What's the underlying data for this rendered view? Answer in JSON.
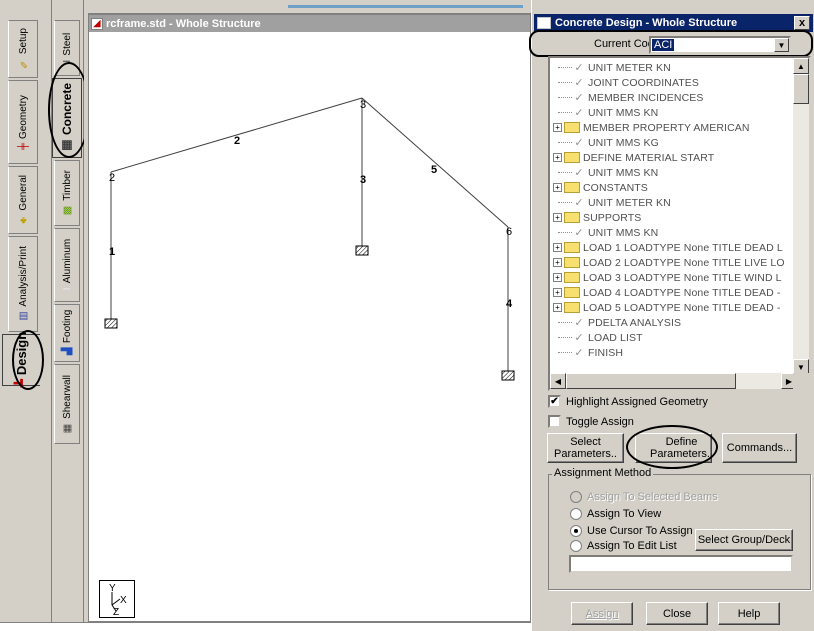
{
  "outer_tabs": [
    {
      "label": "Setup",
      "icon": "setup-icon"
    },
    {
      "label": "Geometry",
      "icon": "geometry-icon"
    },
    {
      "label": "General",
      "icon": "general-icon"
    },
    {
      "label": "Analysis/Print",
      "icon": "analysis-icon"
    },
    {
      "label": "Design",
      "icon": "design-icon",
      "active": true
    }
  ],
  "inner_tabs": [
    {
      "label": "Steel",
      "icon": "steel-icon"
    },
    {
      "label": "Concrete",
      "icon": "concrete-icon",
      "active": true
    },
    {
      "label": "Timber",
      "icon": "timber-icon"
    },
    {
      "label": "Aluminum",
      "icon": "aluminum-icon"
    },
    {
      "label": "Footing",
      "icon": "footing-icon"
    },
    {
      "label": "Shearwall",
      "icon": "shearwall-icon"
    }
  ],
  "drawing_window": {
    "title": "rcframe.std - Whole Structure",
    "node_labels": [
      "2",
      "3",
      "6"
    ],
    "member_labels": [
      "1",
      "2",
      "3",
      "5",
      "4"
    ],
    "axis_labels": {
      "y": "Y",
      "z": "Z",
      "x": "X"
    }
  },
  "dialog": {
    "title": "Concrete Design - Whole Structure",
    "close_glyph": "x",
    "current_code_label": "Current Code:",
    "current_code_value": "ACI",
    "tree_items": [
      {
        "type": "check",
        "text": "UNIT METER KN"
      },
      {
        "type": "check",
        "text": "JOINT COORDINATES"
      },
      {
        "type": "check",
        "text": "MEMBER INCIDENCES"
      },
      {
        "type": "check",
        "text": "UNIT MMS KN"
      },
      {
        "type": "folder",
        "text": "MEMBER PROPERTY AMERICAN"
      },
      {
        "type": "check",
        "text": "UNIT MMS KG"
      },
      {
        "type": "folder",
        "text": "DEFINE MATERIAL START"
      },
      {
        "type": "check",
        "text": "UNIT MMS KN"
      },
      {
        "type": "folder",
        "text": "CONSTANTS"
      },
      {
        "type": "check",
        "text": "UNIT METER KN"
      },
      {
        "type": "folder",
        "text": "SUPPORTS"
      },
      {
        "type": "check",
        "text": "UNIT MMS KN"
      },
      {
        "type": "folder",
        "text": "LOAD 1 LOADTYPE None  TITLE DEAD L"
      },
      {
        "type": "folder",
        "text": "LOAD 2 LOADTYPE None  TITLE LIVE LO"
      },
      {
        "type": "folder",
        "text": "LOAD 3 LOADTYPE None  TITLE WIND L"
      },
      {
        "type": "folder",
        "text": "LOAD 4 LOADTYPE None  TITLE DEAD -"
      },
      {
        "type": "folder",
        "text": "LOAD 5 LOADTYPE None  TITLE DEAD -"
      },
      {
        "type": "check",
        "text": "PDELTA ANALYSIS"
      },
      {
        "type": "check",
        "text": "LOAD LIST"
      },
      {
        "type": "check",
        "text": "FINISH"
      }
    ],
    "highlight_label": "Highlight Assigned Geometry",
    "highlight_checked": true,
    "toggle_label": "Toggle Assign",
    "toggle_checked": false,
    "select_params_line1": "Select",
    "select_params_line2": "Parameters..",
    "define_params_line1": "Define",
    "define_params_line2": "Parameters..",
    "commands_label": "Commands...",
    "assignment_method_label": "Assignment Method",
    "radio_options": [
      {
        "label": "Assign To Selected Beams",
        "disabled": true,
        "selected": false
      },
      {
        "label": "Assign To View",
        "disabled": false,
        "selected": false
      },
      {
        "label": "Use Cursor To Assign",
        "disabled": false,
        "selected": true
      },
      {
        "label": "Assign To Edit List",
        "disabled": false,
        "selected": false
      }
    ],
    "select_group_label": "Select Group/Deck",
    "edit_list_value": "",
    "assign_label": "Assign",
    "close_label": "Close",
    "help_label": "Help"
  }
}
